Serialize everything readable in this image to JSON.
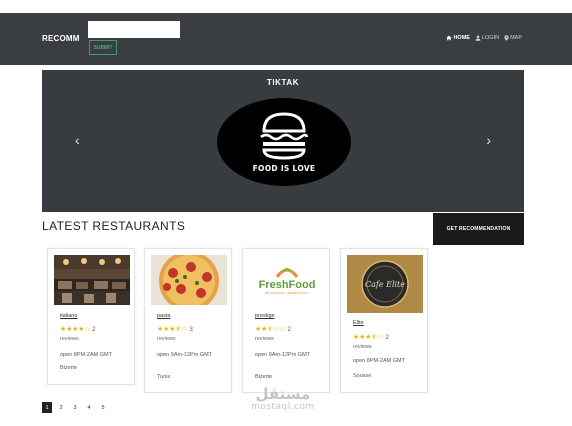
{
  "header": {
    "brand": "RECOMM",
    "search": {
      "value": "",
      "placeholder": ""
    },
    "submit_label": "SUBMIT",
    "nav": [
      {
        "label": "HOME",
        "icon": "home-icon",
        "active": true
      },
      {
        "label": "LOGIN",
        "icon": "user-icon",
        "active": false
      },
      {
        "label": "MAP",
        "icon": "map-pin-icon",
        "active": false
      }
    ]
  },
  "carousel": {
    "title": "TIKTAK",
    "logo_text": "FOOD IS LOVE",
    "prev_glyph": "‹",
    "next_glyph": "›"
  },
  "section": {
    "title": "LATEST RESTAURANTS",
    "recommend_label": "GET RECOMMENDATION"
  },
  "restaurants": [
    {
      "name": "italiano",
      "stars": "★★★★☆",
      "count": "2",
      "reviews": "reviews",
      "hours": "open 8PM-2AM GMT",
      "city": "Bizerte"
    },
    {
      "name": "pasta",
      "stars": "★★★⯪☆",
      "count": "3",
      "reviews": "reviews",
      "hours": "open 9Am-12Pm GMT",
      "city": "Tunis"
    },
    {
      "name": "prestige",
      "stars": "★★⯪☆☆",
      "count": "2",
      "reviews": "reviews",
      "hours": "open 9Am-12Pm GMT",
      "city": "Bizerte"
    },
    {
      "name": "Elite",
      "stars": "★★★⯪☆",
      "count": "2",
      "reviews": "reviews",
      "hours": "open 8PM-2AM GMT",
      "city": "Sousse"
    }
  ],
  "card_images": {
    "freshfood_title": "FreshFood",
    "freshfood_tagline": "BE CREATIVE · BE BEAUTIFUL",
    "elite_text": "Cafe Elite"
  },
  "pagination": [
    "1",
    "2",
    "3",
    "4",
    "5"
  ],
  "watermark": {
    "logo": "مستقل",
    "text": "mostaql.com"
  },
  "colors": {
    "topbar": "#3a3d41",
    "carousel": "#383b3f",
    "star": "#e5b80b",
    "submit": "#2fa26a"
  }
}
